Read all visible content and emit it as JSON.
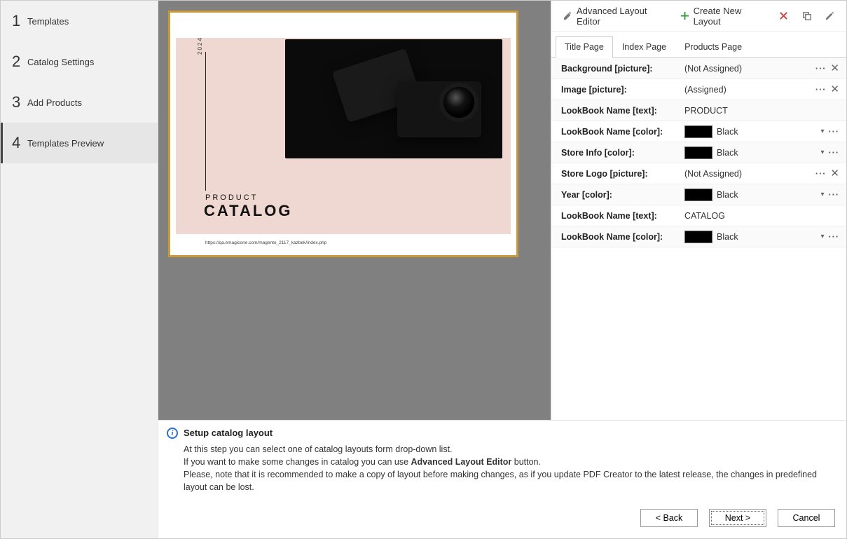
{
  "sidebar": {
    "steps": [
      {
        "num": "1",
        "label": "Templates"
      },
      {
        "num": "2",
        "label": "Catalog Settings"
      },
      {
        "num": "3",
        "label": "Add Products"
      },
      {
        "num": "4",
        "label": "Templates Preview"
      }
    ]
  },
  "preview": {
    "year": "2024",
    "title": "PRODUCT",
    "catalog": "CATALOG",
    "url": "https://qa.emagicone.com/magento_2117_kazbek/index.php"
  },
  "toolbar": {
    "adv_layout": "Advanced Layout Editor",
    "create_new": "Create New Layout"
  },
  "tabs": [
    {
      "label": "Title Page"
    },
    {
      "label": "Index Page"
    },
    {
      "label": "Products Page"
    }
  ],
  "properties": [
    {
      "label": "Background [picture]:",
      "type": "picture",
      "value": "(Not Assigned)"
    },
    {
      "label": "Image [picture]:",
      "type": "picture",
      "value": "(Assigned)"
    },
    {
      "label": "LookBook Name [text]:",
      "type": "text",
      "value": "PRODUCT"
    },
    {
      "label": "LookBook Name [color]:",
      "type": "color",
      "value": "Black"
    },
    {
      "label": "Store Info [color]:",
      "type": "color",
      "value": "Black"
    },
    {
      "label": "Store Logo [picture]:",
      "type": "picture",
      "value": "(Not Assigned)"
    },
    {
      "label": "Year [color]:",
      "type": "color",
      "value": "Black"
    },
    {
      "label": "LookBook Name [text]:",
      "type": "text",
      "value": "CATALOG"
    },
    {
      "label": "LookBook Name [color]:",
      "type": "color",
      "value": "Black"
    }
  ],
  "info": {
    "title": "Setup catalog layout",
    "line1": "At this step you can select one of catalog layouts form drop-down list.",
    "line2a": "If you want to make some changes in catalog you can use ",
    "line2b": "Advanced Layout Editor",
    "line2c": " button.",
    "line3": "Please, note that it is recommended to make a copy of layout before making changes, as if you update PDF Creator to the latest release, the changes in predefined layout can be lost."
  },
  "buttons": {
    "back": "< Back",
    "next": "Next >",
    "cancel": "Cancel"
  }
}
